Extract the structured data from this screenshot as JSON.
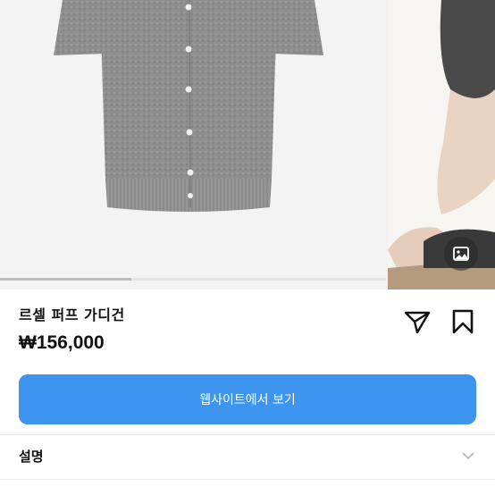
{
  "carousel": {
    "progress": 0.34,
    "main_image": "gray-short-sleeve-cardigan-product-photo",
    "side_image": "model-wearing-cardigan-photo"
  },
  "product": {
    "title": "르셀 퍼프 가디건",
    "price": "₩156,000"
  },
  "actions": {
    "share_icon": "paper-plane-share-icon",
    "bookmark_icon": "bookmark-icon",
    "gallery_icon": "image-gallery-icon"
  },
  "cta": {
    "label": "웹사이트에서 보기",
    "color": "#3d95f0"
  },
  "description": {
    "label": "설명",
    "state": "collapsed"
  }
}
